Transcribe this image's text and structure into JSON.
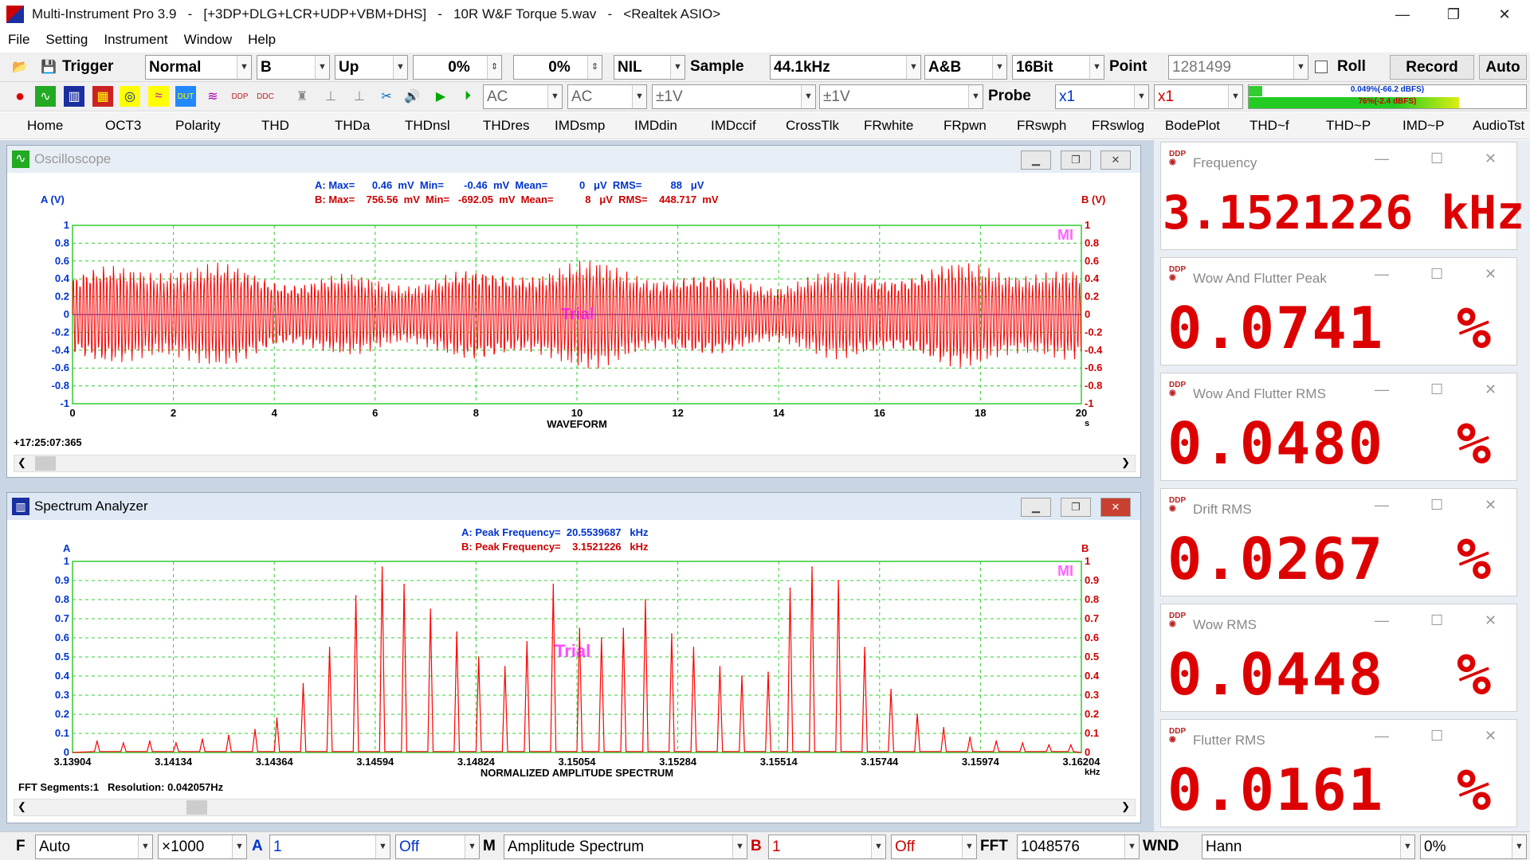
{
  "window": {
    "title": "Multi-Instrument Pro 3.9   -   [+3DP+DLG+LCR+UDP+VBM+DHS]   -   10R W&F Torque 5.wav   -   <Realtek ASIO>",
    "minimize": "—",
    "restore": "❐",
    "close": "✕"
  },
  "menu": [
    "File",
    "Setting",
    "Instrument",
    "Window",
    "Help"
  ],
  "toolbar1": {
    "trigger_label": "Trigger",
    "trigger_mode": "Normal",
    "trigger_channel": "B",
    "trigger_edge": "Up",
    "trigger_level": "0%",
    "trigger_delay": "0%",
    "nil": "NIL",
    "sample_label": "Sample",
    "sample_rate": "44.1kHz",
    "channels": "A&B",
    "bits": "16Bit",
    "point_label": "Point",
    "points": "1281499",
    "roll_label": "Roll",
    "record_label": "Record",
    "auto_label": "Auto"
  },
  "toolbar2": {
    "coupling_a": "AC",
    "coupling_b": "AC",
    "range_a": "±1V",
    "range_b": "±1V",
    "probe_label": "Probe",
    "probe_a": "x1",
    "probe_b": "x1",
    "level_a": "0.049%(-66.2 dBFS)",
    "level_b": "76%(-2.4 dBFS)",
    "level_a_fill": 0.05,
    "level_b_fill": 0.76
  },
  "tabs": [
    "Home",
    "OCT3",
    "Polarity",
    "THD",
    "THDa",
    "THDnsl",
    "THDres",
    "IMDsmp",
    "IMDdin",
    "IMDccif",
    "CrossTlk",
    "FRwhite",
    "FRpwn",
    "FRswph",
    "FRswlog",
    "BodePlot",
    "THD~f",
    "THD~P",
    "IMD~P",
    "AudioTst"
  ],
  "oscilloscope": {
    "title": "Oscilloscope",
    "stat_a": "A: Max=      0.46  mV  Min=       -0.46  mV  Mean=           0   μV  RMS=          88   μV",
    "stat_b": "B: Max=    756.56  mV  Min=   -692.05  mV  Mean=           8   μV  RMS=    448.717  mV",
    "axis_left": "A (V)",
    "axis_right": "B (V)",
    "xlabel": "WAVEFORM",
    "xunit": "s",
    "timestamp": "+17:25:07:365",
    "trial": "Trial",
    "mi": "MI"
  },
  "spectrum": {
    "title": "Spectrum Analyzer",
    "stat_a": "A: Peak Frequency=  20.5539687   kHz",
    "stat_b": "B: Peak Frequency=    3.1521226   kHz",
    "axis_left": "A",
    "axis_right": "B",
    "xlabel": "NORMALIZED AMPLITUDE SPECTRUM",
    "xunit": "kHz",
    "fft_info": "FFT Segments:1   Resolution: 0.042057Hz",
    "trial": "Trial",
    "mi": "MI"
  },
  "chart_data": [
    {
      "type": "line",
      "xlabel": "WAVEFORM",
      "x_ticks": [
        "0",
        "2",
        "4",
        "6",
        "8",
        "10",
        "12",
        "14",
        "16",
        "18",
        "20"
      ],
      "y_ticks": [
        "1",
        "0.8",
        "0.6",
        "0.4",
        "0.2",
        "0",
        "-0.2",
        "-0.4",
        "-0.6",
        "-0.8",
        "-1"
      ],
      "xlim": [
        0,
        20
      ],
      "ylim": [
        -1,
        1
      ],
      "grid": true,
      "series": [
        {
          "name": "B",
          "color": "#ff0000",
          "amplitude": 0.62
        }
      ]
    },
    {
      "type": "line",
      "xlabel": "NORMALIZED AMPLITUDE SPECTRUM",
      "x_ticks": [
        "3.13904",
        "3.14134",
        "3.14364",
        "3.14594",
        "3.14824",
        "3.15054",
        "3.15284",
        "3.15514",
        "3.15744",
        "3.15974",
        "3.16204"
      ],
      "y_ticks": [
        "1",
        "0.9",
        "0.8",
        "0.7",
        "0.6",
        "0.5",
        "0.4",
        "0.3",
        "0.2",
        "0.1",
        "0"
      ],
      "xlim": [
        3.13904,
        3.16204
      ],
      "ylim": [
        0,
        1
      ],
      "grid": true,
      "series": [
        {
          "name": "B",
          "color": "#ff0000",
          "peaks_x": [
            3.1396,
            3.1402,
            3.1408,
            3.1414,
            3.142,
            3.1426,
            3.1432,
            3.1437,
            3.1443,
            3.1449,
            3.1455,
            3.1461,
            3.1466,
            3.1472,
            3.1478,
            3.1483,
            3.1489,
            3.1494,
            3.15,
            3.1506,
            3.1511,
            3.1516,
            3.1521,
            3.1527,
            3.1532,
            3.1538,
            3.1543,
            3.1549,
            3.1554,
            3.1559,
            3.1565,
            3.1571,
            3.1577,
            3.1583,
            3.1589,
            3.1595,
            3.1601,
            3.1607,
            3.1613,
            3.1618
          ],
          "peaks_y": [
            0.06,
            0.05,
            0.06,
            0.05,
            0.07,
            0.09,
            0.12,
            0.18,
            0.36,
            0.55,
            0.82,
            0.97,
            0.88,
            0.75,
            0.63,
            0.5,
            0.45,
            0.58,
            0.88,
            0.65,
            0.6,
            0.65,
            0.8,
            0.62,
            0.55,
            0.45,
            0.4,
            0.42,
            0.86,
            0.97,
            0.9,
            0.55,
            0.33,
            0.2,
            0.13,
            0.08,
            0.06,
            0.05,
            0.04,
            0.04
          ]
        }
      ]
    }
  ],
  "meters": [
    {
      "title": "Frequency",
      "value": "3.1521226 kHz"
    },
    {
      "title": "Wow And Flutter Peak",
      "value": "0.0741  %"
    },
    {
      "title": "Wow And Flutter RMS",
      "value": "0.0480  %"
    },
    {
      "title": "Drift RMS",
      "value": "0.0267  %"
    },
    {
      "title": "Wow RMS",
      "value": "0.0448  %"
    },
    {
      "title": "Flutter RMS",
      "value": "0.0161  %"
    }
  ],
  "bottombar": {
    "f_label": "F",
    "freq_range": "Auto",
    "zoom": "×1000",
    "a_label": "A",
    "a_avg": "1",
    "a_off": "Off",
    "m_label": "M",
    "mode": "Amplitude Spectrum",
    "b_label": "B",
    "b_avg": "1",
    "b_off": "Off",
    "fft_label": "FFT",
    "fft_size": "1048576",
    "wnd_label": "WND",
    "window": "Hann",
    "overlap": "0%"
  },
  "colors": {
    "accent_red": "#dd0000",
    "accent_blue": "#0033cc",
    "grid_green": "#33cc33",
    "trial": "#ff00ff"
  }
}
